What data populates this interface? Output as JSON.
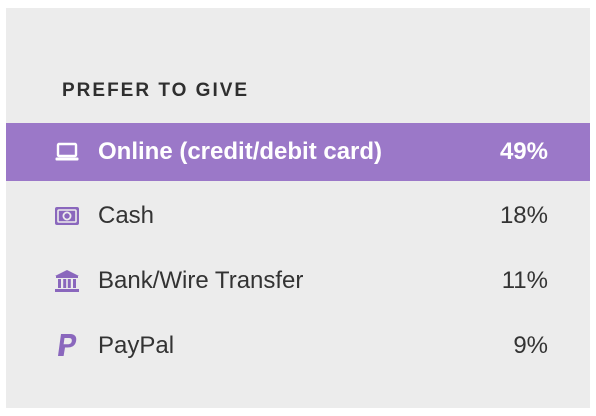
{
  "section": {
    "title": "PREFER TO GIVE"
  },
  "accent_color": "#9b78c8",
  "icon_color": "#8a67bd",
  "items": [
    {
      "label": "Online (credit/debit card)",
      "percent": "49%",
      "icon": "laptop-icon",
      "highlighted": true
    },
    {
      "label": "Cash",
      "percent": "18%",
      "icon": "cash-icon",
      "highlighted": false
    },
    {
      "label": "Bank/Wire Transfer",
      "percent": "11%",
      "icon": "bank-icon",
      "highlighted": false
    },
    {
      "label": "PayPal",
      "percent": "9%",
      "icon": "paypal-icon",
      "highlighted": false
    }
  ]
}
